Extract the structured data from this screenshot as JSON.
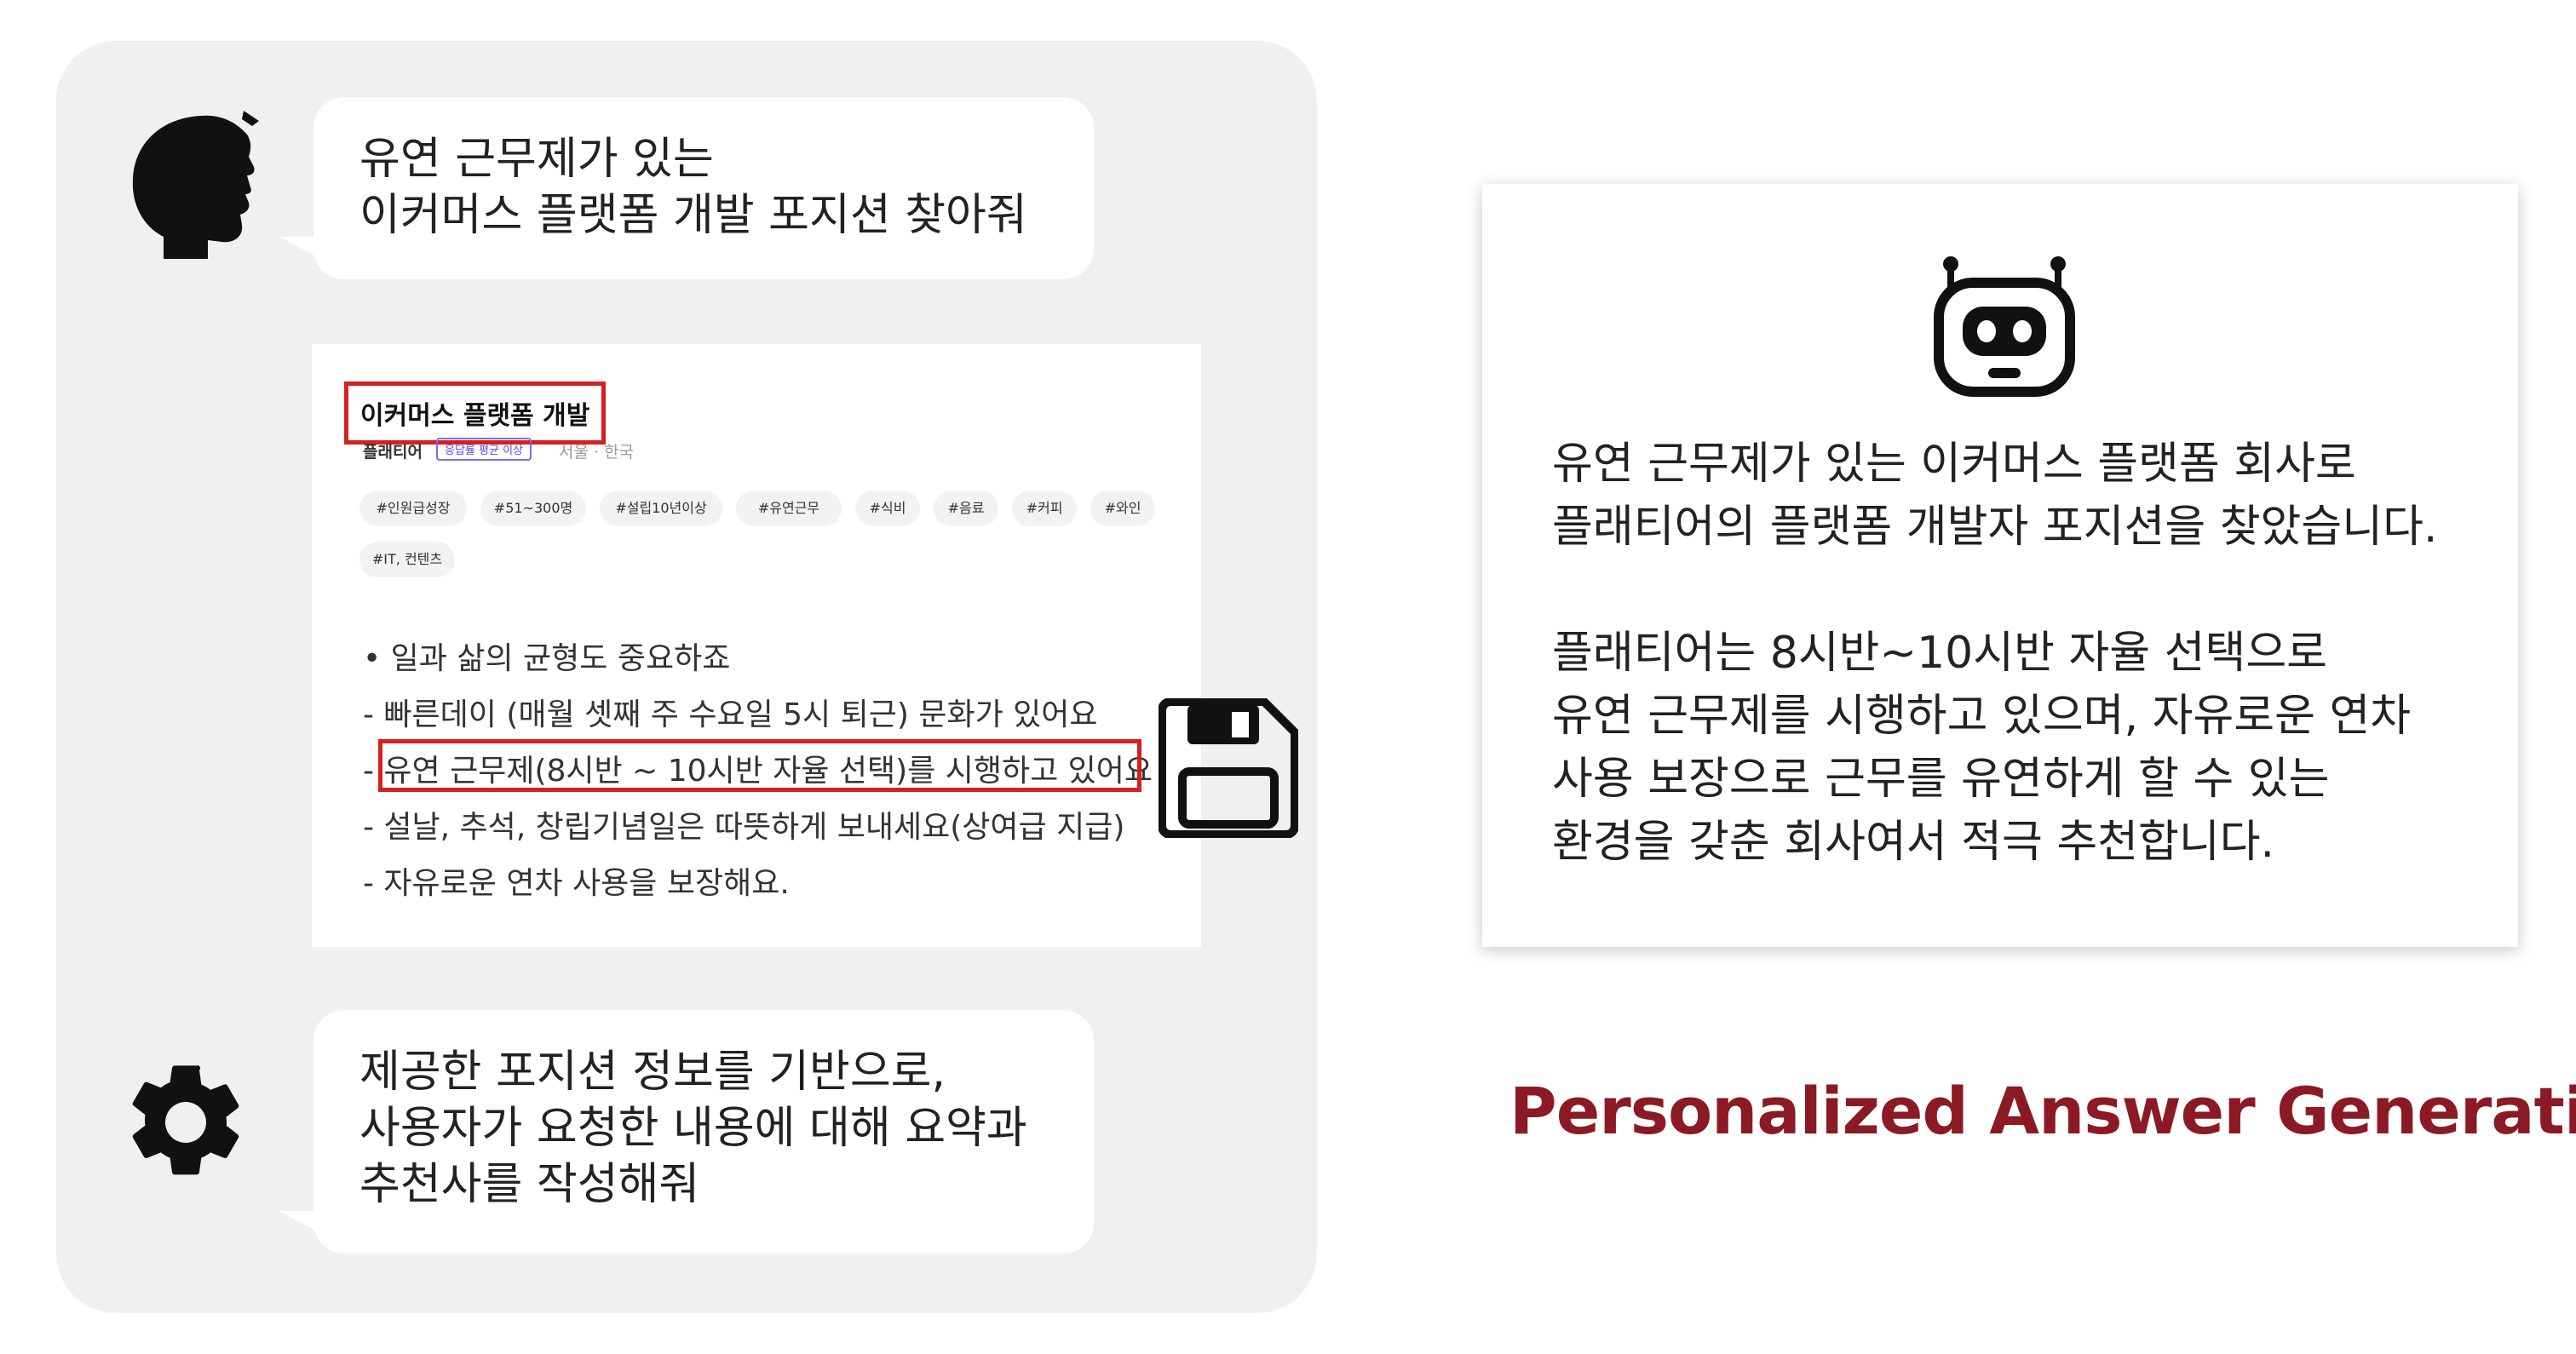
{
  "user_query": {
    "lines": [
      "유연 근무제가 있는",
      "이커머스 플랫폼 개발 포지션 찾아줘"
    ]
  },
  "job_card": {
    "title": "이커머스 플랫폼 개발",
    "company": "플래티어",
    "badge": "응답률 평균 이상",
    "location": "서울 · 한국",
    "tags": [
      "#인원급성장",
      "#51~300명",
      "#설립10년이상",
      "#유연근무",
      "#식비",
      "#음료",
      "#커피",
      "#와인",
      "#IT, 컨텐츠"
    ],
    "benefits": [
      "• 일과 삶의 균형도 중요하죠",
      "- 빠른데이 (매월 셋째 주 수요일 5시 퇴근) 문화가 있어요",
      "- 유연 근무제(8시반 ~ 10시반 자율 선택)를 시행하고 있어요",
      "- 설날, 추석, 창립기념일은 따뜻하게 보내세요(상여급 지급)",
      "- 자유로운 연차 사용을 보장해요."
    ]
  },
  "system_prompt": {
    "lines": [
      "제공한 포지션 정보를 기반으로,",
      "사용자가 요청한 내용에 대해 요약과",
      "추천사를 작성해줘"
    ]
  },
  "answer": {
    "paragraph1": [
      "유연 근무제가 있는 이커머스 플랫폼 회사로",
      "플래티어의 플랫폼 개발자 포지션을 찾았습니다."
    ],
    "paragraph2": [
      "플래티어는 8시반~10시반 자율 선택으로",
      "유연 근무제를 시행하고 있으며, 자유로운 연차",
      "사용 보장으로 근무를 유연하게 할 수 있는",
      "환경을 갖춘 회사여서 적극 추천합니다."
    ]
  },
  "caption": "Personalized Answer Generation",
  "colors": {
    "panel": "#f0f0f0",
    "highlight": "#d42020",
    "caption": "#8b1a24"
  },
  "icons": {
    "user": "head-silhouette-icon",
    "system": "gear-icon",
    "save": "floppy-disk-icon",
    "assistant": "robot-icon"
  }
}
